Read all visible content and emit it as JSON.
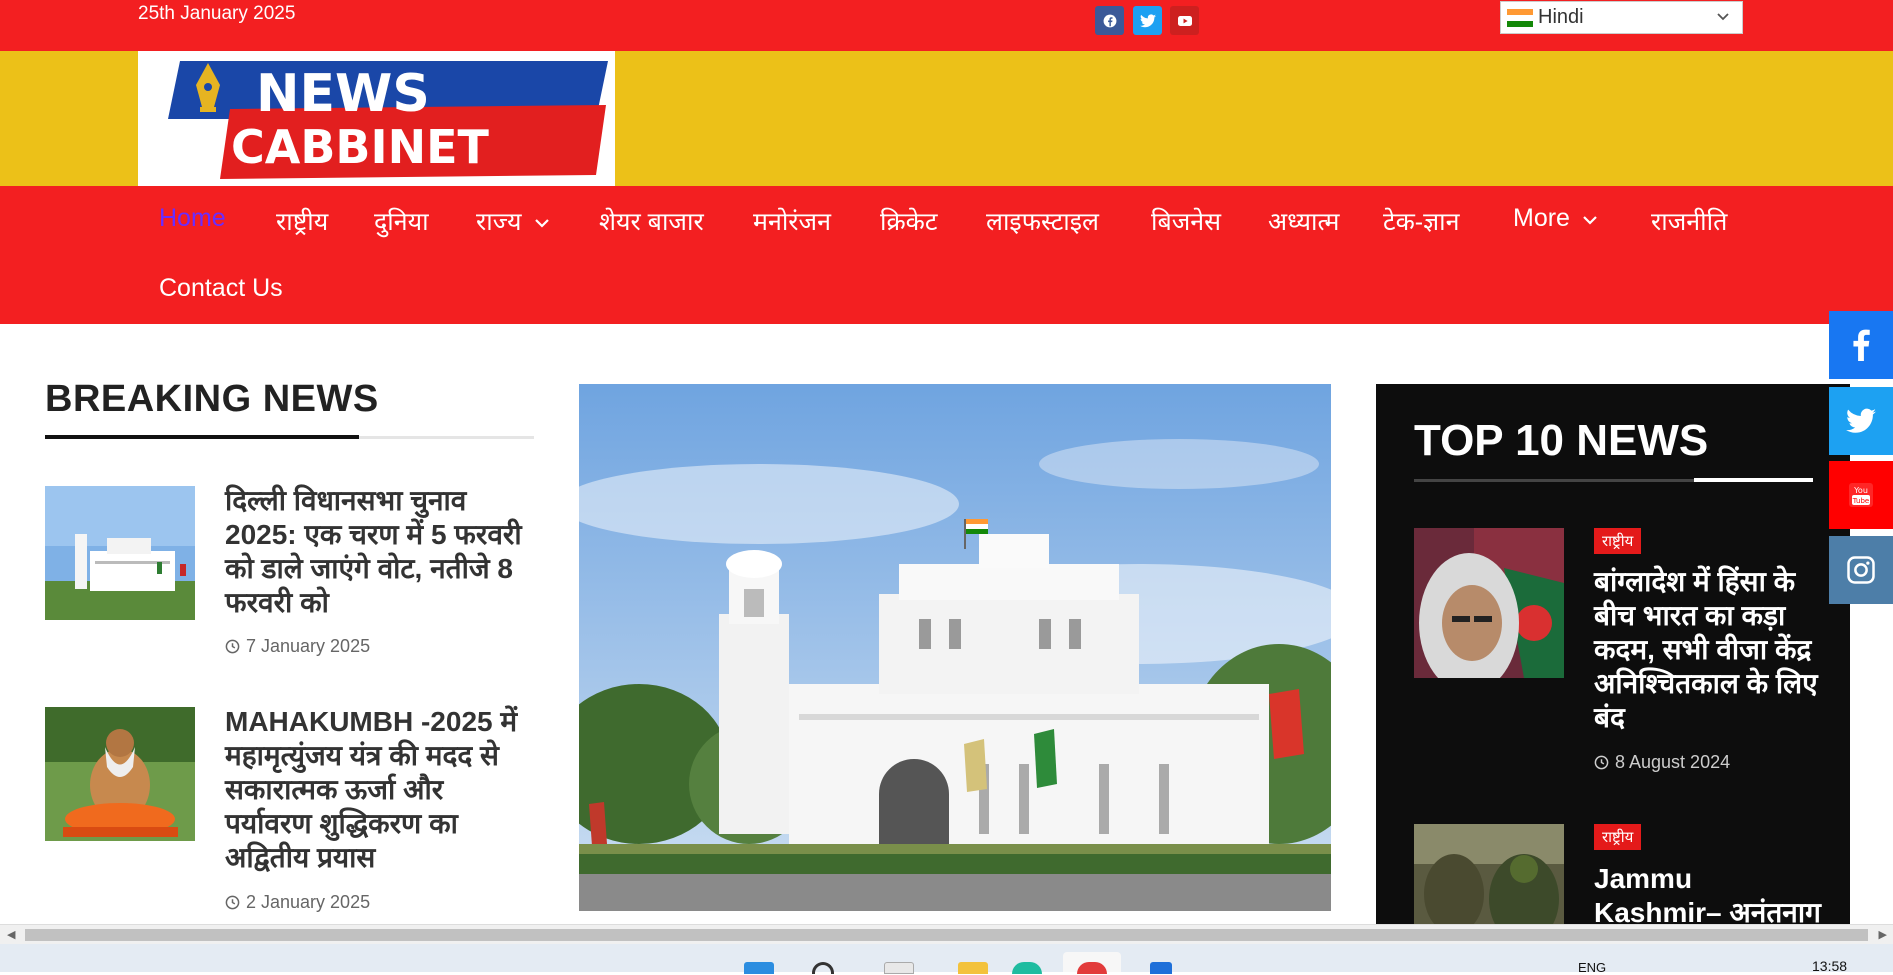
{
  "topbar": {
    "date": "25th January 2025",
    "language": {
      "selected": "Hindi"
    },
    "social": [
      "facebook-icon",
      "twitter-icon",
      "youtube-icon"
    ]
  },
  "nav": {
    "items": [
      {
        "label": "Home",
        "active": true
      },
      {
        "label": "राष्ट्रीय"
      },
      {
        "label": "दुनिया"
      },
      {
        "label": "राज्य",
        "dropdown": true
      },
      {
        "label": "शेयर बाजार"
      },
      {
        "label": "मनोरंजन"
      },
      {
        "label": "क्रिकेट"
      },
      {
        "label": "लाइफस्टाइल"
      },
      {
        "label": "बिजनेस"
      },
      {
        "label": "अध्यात्म"
      },
      {
        "label": "टेक-ज्ञान"
      },
      {
        "label": "More",
        "dropdown": true
      },
      {
        "label": "राजनीति"
      },
      {
        "label": "Contact Us"
      }
    ]
  },
  "breaking": {
    "title": "BREAKING NEWS",
    "articles": [
      {
        "title": "दिल्ली विधानसभा चुनाव 2025: एक चरण में 5 फरवरी को डाले जाएंगे वोट, नतीजे 8 फरवरी को",
        "date": "7 January 2025"
      },
      {
        "title": "MAHAKUMBH -2025 में महामृत्युंजय यंत्र की मदद से सकारात्मक ऊर्जा और पर्यावरण शुद्धिकरण का अद्वितीय प्रयास",
        "date": "2 January 2025"
      }
    ]
  },
  "top10": {
    "title": "TOP 10 NEWS",
    "items": [
      {
        "badge": "राष्ट्रीय",
        "title": "बांग्लादेश में हिंसा के बीच भारत का कड़ा कदम, सभी वीजा केंद्र अनिश्चितकाल के लिए बंद",
        "date": "8 August 2024"
      },
      {
        "badge": "राष्ट्रीय",
        "title": "Jammu Kashmir– अनंतनाग में"
      }
    ]
  },
  "side_social": [
    "facebook-icon",
    "twitter-icon",
    "youtube-icon",
    "instagram-icon"
  ],
  "taskbar": {
    "lang": "ENG",
    "time": "13:58"
  },
  "colors": {
    "red": "#f31f21",
    "yellow": "#ecc118",
    "active_nav": "#6a2cff",
    "dark_panel": "#0d0d0d"
  }
}
